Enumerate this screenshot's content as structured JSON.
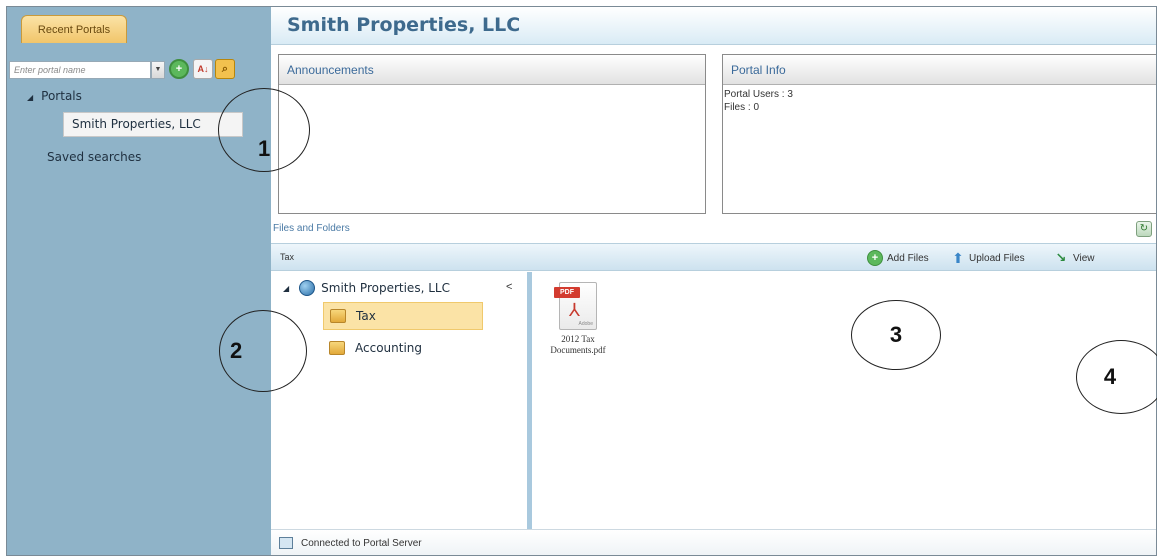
{
  "sidebar": {
    "tab_label": "Recent Portals",
    "search_placeholder": "Enter portal name",
    "tree": {
      "root_label": "Portals",
      "selected_item": "Smith Properties, LLC",
      "saved_searches": "Saved searches"
    }
  },
  "header": {
    "title": "Smith Properties, LLC"
  },
  "announcements": {
    "title": "Announcements"
  },
  "portal_info": {
    "title": "Portal Info",
    "users_line": "Portal Users : 3",
    "files_line": "Files : 0"
  },
  "files_section": {
    "label": "Files and Folders",
    "breadcrumb": "Tax",
    "toolbar": {
      "add_label": "Add Files",
      "upload_label": "Upload Files",
      "view_label": "View"
    },
    "folder_tree": {
      "root": "Smith Properties, LLC",
      "collapse_glyph": "<",
      "children": [
        "Tax",
        "Accounting"
      ]
    },
    "files": [
      {
        "name_line1": "2012 Tax",
        "name_line2": "Documents.pdf",
        "badge": "PDF",
        "brand": "Adobe"
      }
    ]
  },
  "status_bar": {
    "text": "Connected to Portal Server"
  },
  "callouts": [
    "1",
    "2",
    "3",
    "4"
  ],
  "colors": {
    "sidebar_bg": "#8fb3c8",
    "title_color": "#3e6a8d",
    "tab_bg": "#f1c56a",
    "selected_folder_bg": "#fbe3a6",
    "pdf_red": "#d33b2f"
  }
}
